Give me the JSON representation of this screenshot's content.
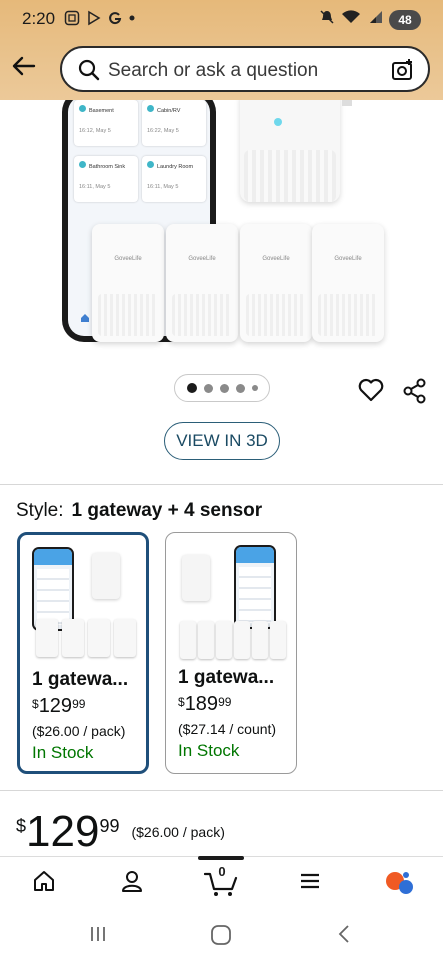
{
  "status_bar": {
    "time": "2:20",
    "battery": "48",
    "icons": [
      "screenshot-icon",
      "play-store-icon",
      "google-icon",
      "notification-dot-icon",
      "mute-icon",
      "wifi-icon",
      "signal-icon",
      "battery-icon"
    ]
  },
  "header": {
    "search_placeholder": "Search or ask a question",
    "icons": [
      "back-arrow-icon",
      "search-icon",
      "camera-search-icon"
    ],
    "gradient_color": "#e6b97a"
  },
  "product_image": {
    "rooms": [
      {
        "name": "Basement",
        "time": "16:12, May 5"
      },
      {
        "name": "Cabin/RV",
        "time": "16:22, May 5"
      },
      {
        "name": "Bathroom Sink",
        "time": "16:11, May 5"
      },
      {
        "name": "Laundry Room",
        "time": "16:11, May 5"
      }
    ],
    "sensor_brand": "GoveeLife"
  },
  "carousel": {
    "count": 5,
    "active_index": 0
  },
  "actions": {
    "view_3d_label": "VIEW IN 3D",
    "icons": [
      "heart-icon",
      "share-icon"
    ]
  },
  "style": {
    "label": "Style:",
    "value": "1 gateway + 4 sensor"
  },
  "variants": [
    {
      "title": "1 gatewa...",
      "currency": "$",
      "price_whole": "129",
      "price_fraction": "99",
      "unit_price": "($26.00 / pack)",
      "stock": "In Stock",
      "selected": true
    },
    {
      "title": "1 gatewa...",
      "currency": "$",
      "price_whole": "189",
      "price_fraction": "99",
      "unit_price": "($27.14 / count)",
      "stock": "In Stock",
      "selected": false
    }
  ],
  "price": {
    "currency": "$",
    "whole": "129",
    "fraction": "99",
    "unit_price": "($26.00 / pack)"
  },
  "bottom_nav": {
    "cart_count": "0",
    "items": [
      "home-icon",
      "account-icon",
      "cart-icon",
      "menu-icon",
      "rufus-assistant-icon"
    ]
  },
  "colors": {
    "accent_border": "#1f4f7a",
    "in_stock": "#007600",
    "view3d": "#2b5e78"
  }
}
